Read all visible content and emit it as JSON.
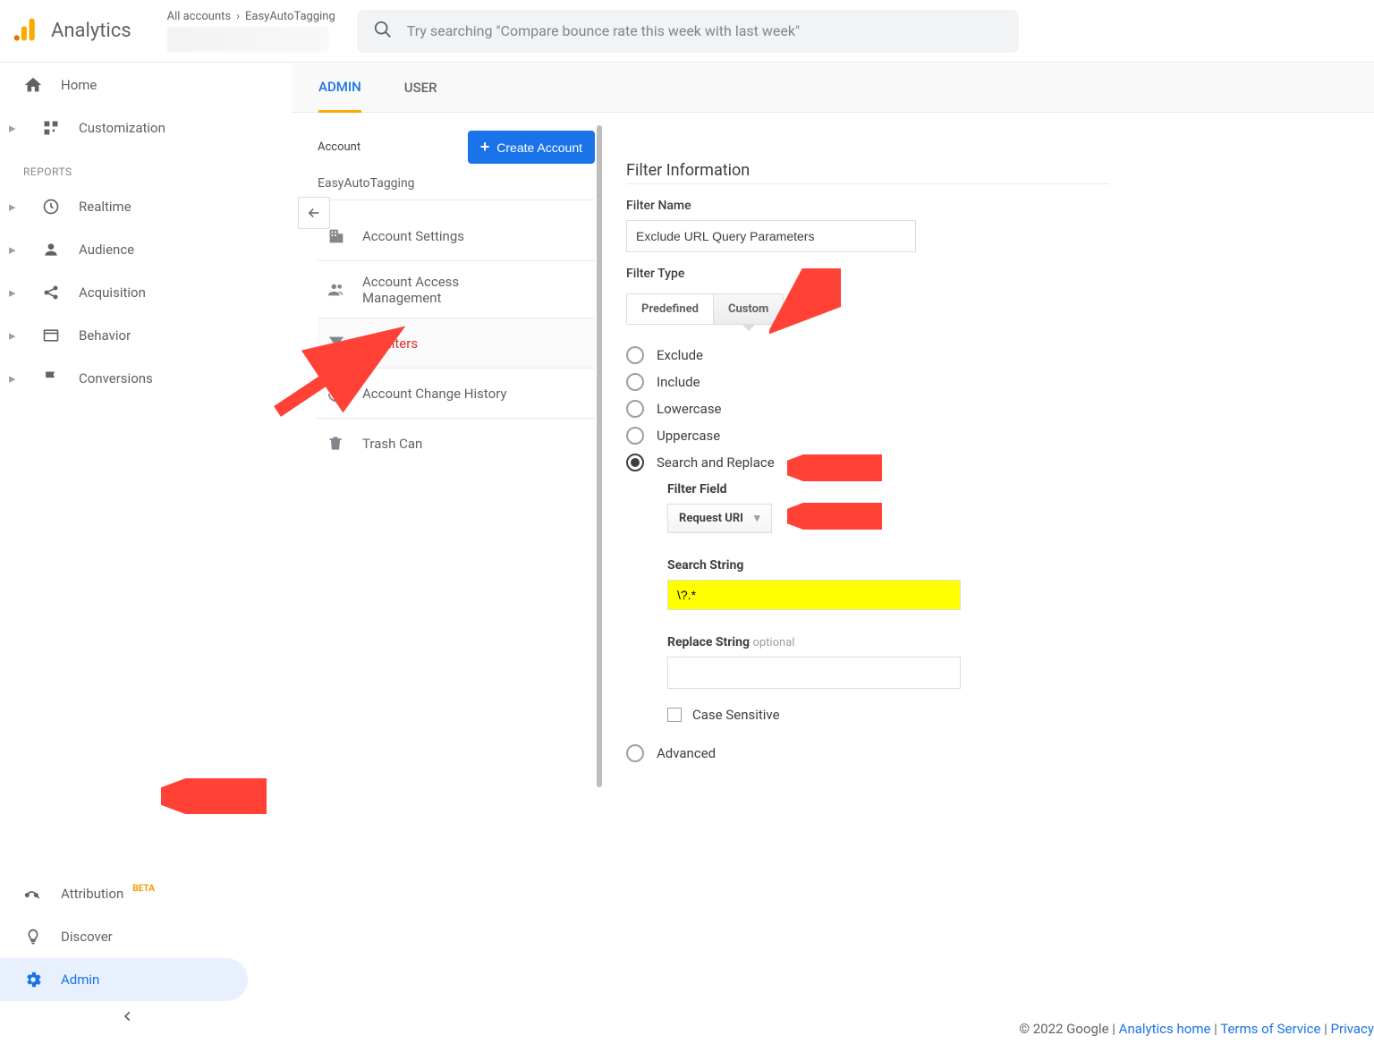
{
  "header": {
    "product": "Analytics",
    "breadcrumb_all": "All accounts",
    "breadcrumb_account": "EasyAutoTagging",
    "search_placeholder": "Try searching \"Compare bounce rate this week with last week\""
  },
  "sidebar": {
    "home": "Home",
    "customization": "Customization",
    "reports_label": "REPORTS",
    "realtime": "Realtime",
    "audience": "Audience",
    "acquisition": "Acquisition",
    "behavior": "Behavior",
    "conversions": "Conversions",
    "attribution": "Attribution",
    "beta": "BETA",
    "discover": "Discover",
    "admin": "Admin"
  },
  "tabs": {
    "admin": "ADMIN",
    "user": "USER"
  },
  "account_col": {
    "label": "Account",
    "create_btn": "Create Account",
    "account_name": "EasyAutoTagging",
    "items": {
      "settings": "Account Settings",
      "access": "Account Access Management",
      "filters": "All Filters",
      "history": "Account Change History",
      "trash": "Trash Can"
    }
  },
  "form": {
    "section": "Filter Information",
    "name_label": "Filter Name",
    "name_value": "Exclude URL Query Parameters",
    "type_label": "Filter Type",
    "predefined": "Predefined",
    "custom": "Custom",
    "radios": {
      "exclude": "Exclude",
      "include": "Include",
      "lowercase": "Lowercase",
      "uppercase": "Uppercase",
      "search_replace": "Search and Replace",
      "advanced": "Advanced"
    },
    "filter_field_label": "Filter Field",
    "filter_field_value": "Request URI",
    "search_string_label": "Search String",
    "search_string_value": "\\?.*",
    "replace_string_label": "Replace String",
    "replace_string_opt": "optional",
    "case_sensitive": "Case Sensitive"
  },
  "footer": {
    "copy": "© 2022 Google",
    "analytics_home": "Analytics home",
    "terms": "Terms of Service",
    "privacy": "Privacy"
  }
}
